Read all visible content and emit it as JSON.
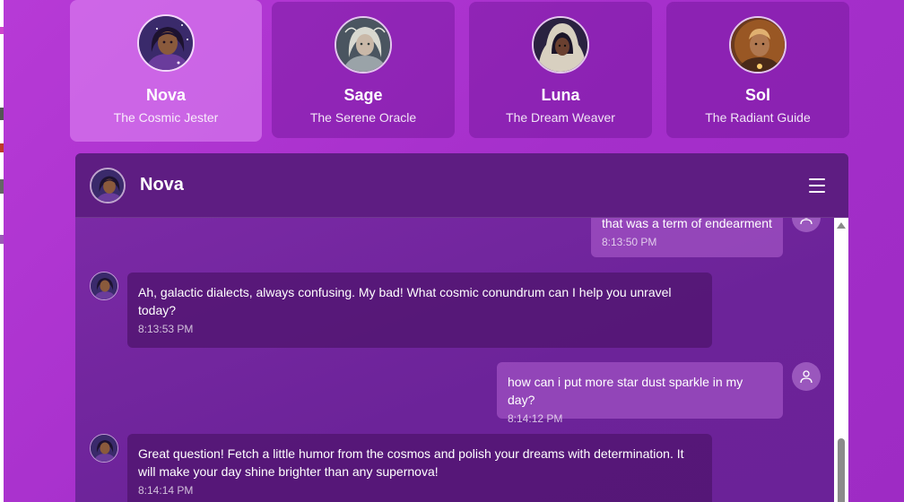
{
  "personas": [
    {
      "name": "Nova",
      "subtitle": "The Cosmic Jester",
      "active": true
    },
    {
      "name": "Sage",
      "subtitle": "The Serene Oracle",
      "active": false
    },
    {
      "name": "Luna",
      "subtitle": "The Dream Weaver",
      "active": false
    },
    {
      "name": "Sol",
      "subtitle": "The Radiant Guide",
      "active": false
    }
  ],
  "chat": {
    "title": "Nova",
    "messages": [
      {
        "role": "user",
        "text": "that was a term of endearment",
        "time": "8:13:50 PM"
      },
      {
        "role": "bot",
        "text": "Ah, galactic dialects, always confusing. My bad! What cosmic conundrum can I help you unravel today?",
        "time": "8:13:53 PM"
      },
      {
        "role": "user",
        "text": "how can i put more star dust sparkle in my day?",
        "time": "8:14:12 PM"
      },
      {
        "role": "bot",
        "text": "Great question! Fetch a little humor from the cosmos and polish your dreams with determination. It will make your day shine brighter than any supernova!",
        "time": "8:14:14 PM"
      }
    ]
  },
  "icons": {
    "menu": "hamburger-menu-icon",
    "user": "user-avatar-icon",
    "scroll_up": "scroll-up-arrow-icon"
  },
  "colors": {
    "background": "#b034d2",
    "chat_header": "#5e1d82",
    "bot_bubble": "#501470",
    "user_bubble": "#b262d2",
    "active_card": "#e18cf5"
  }
}
